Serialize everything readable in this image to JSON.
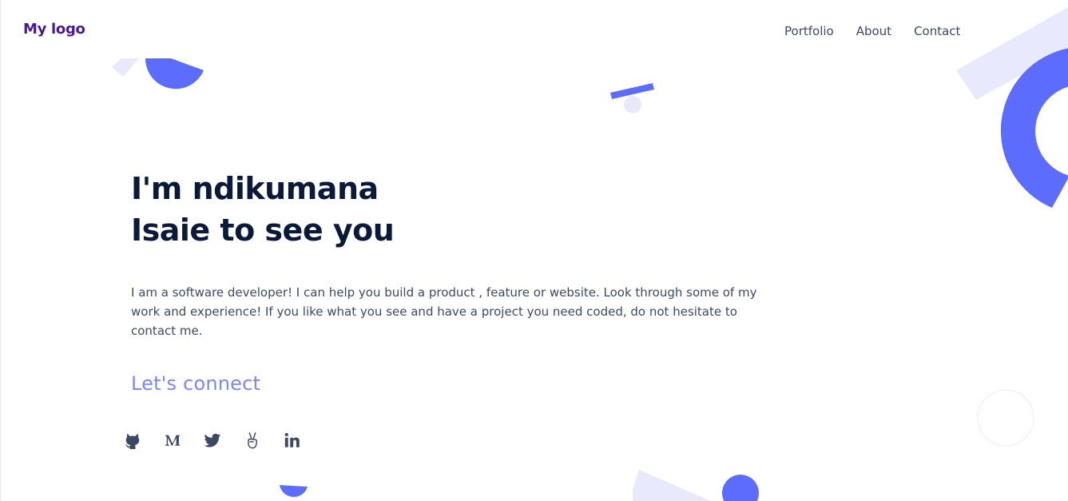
{
  "header": {
    "logo": "My logo",
    "nav": [
      {
        "label": "Portfolio"
      },
      {
        "label": "About"
      },
      {
        "label": "Contact"
      }
    ]
  },
  "hero": {
    "headline_line1": "I'm ndikumana",
    "headline_line2": "Isaie to see you",
    "intro": "I am a software developer! I can help you build a product , feature or website. Look through some of my work and experience! If you like what you see and have a project you need coded, do not hesitate to contact me.",
    "connect_heading": "Let's connect"
  },
  "socials": [
    {
      "icon": "github-icon"
    },
    {
      "icon": "medium-icon"
    },
    {
      "icon": "twitter-icon"
    },
    {
      "icon": "angellist-icon"
    },
    {
      "icon": "linkedin-icon"
    }
  ],
  "colors": {
    "logo": "#4a1891",
    "heading": "#0c1a3a",
    "body_text": "#3d4863",
    "accent": "#7b86f7",
    "shape_blue": "#5b6cff",
    "shape_light": "#e8e9fd",
    "icon": "#3d4863"
  }
}
